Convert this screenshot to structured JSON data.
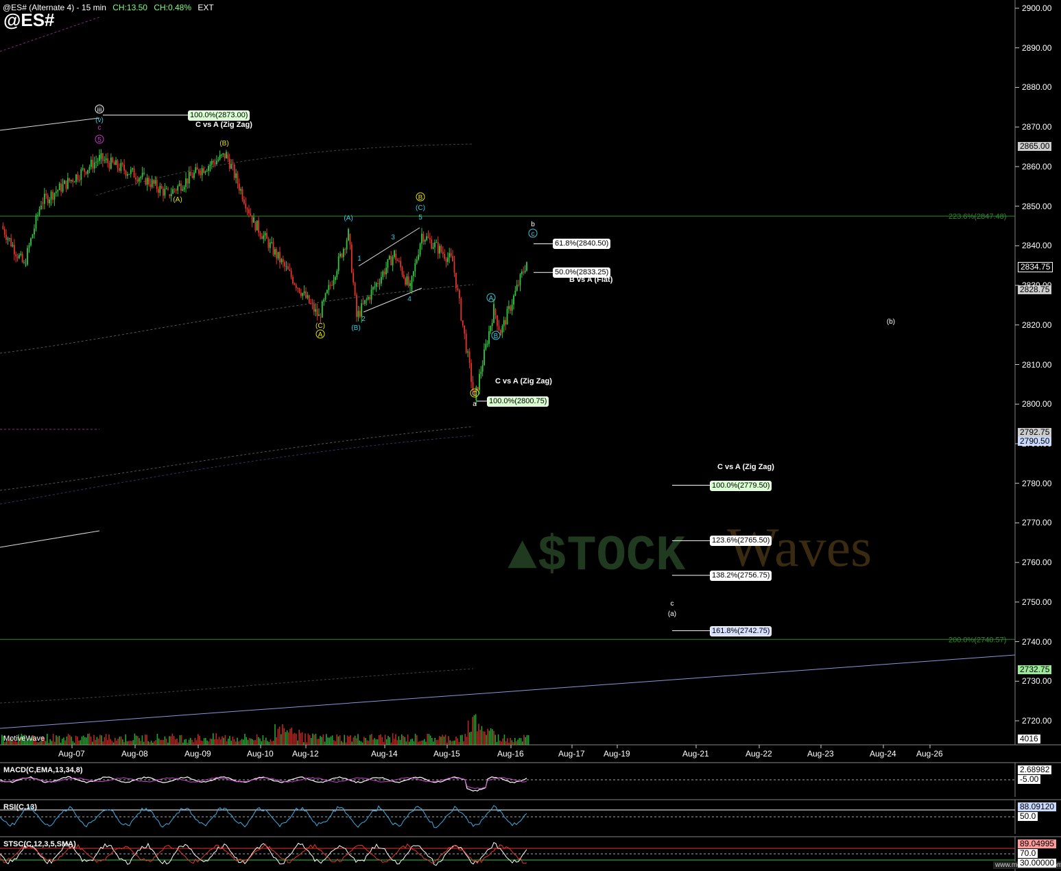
{
  "header": {
    "title": "@ES# (Alternate 4) - 15 min",
    "ch_points": "CH:13.50",
    "ch_pct": "CH:0.48%",
    "session": "EXT",
    "symbol": "@ES#"
  },
  "watermark_logo": "$TOCK Waves",
  "footer_brand": "MotiveWave",
  "footer_site": "www.motivewave.com",
  "colors": {
    "up_candle": "#2ecc40",
    "down_candle": "#e8342a",
    "fib_box_green": "#d8ffd0",
    "fib_box_white": "#ffffff",
    "fib_box_blue": "#d8e0ff",
    "wave_yellow": "#e6e600",
    "wave_cyan": "#33ccdd",
    "wave_magenta": "#cc33cc",
    "fib_line_green": "#2e8b2e"
  },
  "chart_data": {
    "type": "line",
    "title": "@ES# (Alternate 4) - 15 min",
    "ylim": [
      2713,
      2902
    ],
    "y_ticks": [
      2900,
      2890,
      2880,
      2870,
      2860,
      2850,
      2840,
      2830,
      2820,
      2810,
      2800,
      2790,
      2780,
      2770,
      2760,
      2750,
      2740,
      2730,
      2720
    ],
    "y_tick_labels": [
      "2900.00",
      "2890.00",
      "2880.00",
      "2870.00",
      "2860.00",
      "2850.00",
      "2840.00",
      "2830.00",
      "2820.00",
      "2810.00",
      "2800.00",
      "2790.00",
      "2780.00",
      "2770.00",
      "2760.00",
      "2750.00",
      "2740.00",
      "2730.00",
      "2720.00"
    ],
    "x_labels": [
      "Aug-07",
      "Aug-08",
      "Aug-09",
      "Aug-10",
      "Aug-12",
      "Aug-14",
      "Aug-15",
      "Aug-16",
      "Aug-17",
      "Aug-19",
      "Aug-21",
      "Aug-22",
      "Aug-23",
      "Aug-24",
      "Aug-26"
    ],
    "price_path": [
      {
        "x": "Aug-06",
        "y": 2845
      },
      {
        "x": "Aug-07",
        "y": 2835
      },
      {
        "x": "Aug-07",
        "y": 2851
      },
      {
        "x": "Aug-07",
        "y": 2862
      },
      {
        "x": "Aug-08",
        "y": 2857
      },
      {
        "x": "Aug-08",
        "y": 2853
      },
      {
        "x": "Aug-09",
        "y": 2859
      },
      {
        "x": "Aug-09",
        "y": 2863
      },
      {
        "x": "Aug-10",
        "y": 2846
      },
      {
        "x": "Aug-12",
        "y": 2822
      },
      {
        "x": "Aug-12",
        "y": 2843
      },
      {
        "x": "Aug-13",
        "y": 2822
      },
      {
        "x": "Aug-14",
        "y": 2838
      },
      {
        "x": "Aug-14",
        "y": 2829
      },
      {
        "x": "Aug-14",
        "y": 2843
      },
      {
        "x": "Aug-15",
        "y": 2836
      },
      {
        "x": "Aug-15",
        "y": 2801
      },
      {
        "x": "Aug-16",
        "y": 2824
      },
      {
        "x": "Aug-16",
        "y": 2818
      },
      {
        "x": "Aug-16",
        "y": 2836
      }
    ],
    "price_tags": [
      {
        "value": "2865.00",
        "color": "#cccccc"
      },
      {
        "value": "2834.75",
        "color": "#000000",
        "text_color": "#ffffff"
      },
      {
        "value": "2828.75",
        "color": "#cccccc"
      },
      {
        "value": "2792.75",
        "color": "#cccccc"
      },
      {
        "value": "2790.50",
        "color": "#c8d8ff"
      },
      {
        "value": "2732.75",
        "color": "#9be89b"
      }
    ],
    "fib_levels": [
      {
        "label": "100.0%(2873.00)",
        "value": 2873.0,
        "style": "green"
      },
      {
        "label": "61.8%(2840.50)",
        "value": 2840.5,
        "style": "white"
      },
      {
        "label": "50.0%(2833.25)",
        "value": 2833.25,
        "style": "white"
      },
      {
        "label": "100.0%(2800.75)",
        "value": 2800.75,
        "style": "green"
      },
      {
        "label": "100.0%(2779.50)",
        "value": 2779.5,
        "style": "green"
      },
      {
        "label": "123.6%(2765.50)",
        "value": 2765.5,
        "style": "white"
      },
      {
        "label": "138.2%(2756.75)",
        "value": 2756.75,
        "style": "white"
      },
      {
        "label": "161.8%(2742.75)",
        "value": 2742.75,
        "style": "blue"
      }
    ],
    "fib_lines_green": [
      {
        "label": "223.6%(2847.48)",
        "value": 2847.48
      },
      {
        "label": "200.0%(2740.57)",
        "value": 2740.57
      }
    ],
    "projection_titles": [
      "C vs A (Zig Zag)",
      "B vs A (Flat)",
      "C vs A (Zig Zag)",
      "C vs A (Zig Zag)"
    ],
    "wave_labels": [
      "iii",
      "(v)",
      "c",
      "5",
      "(B)",
      "(A)",
      "(C)",
      "A",
      "(A)",
      "(B)",
      "1",
      "2",
      "3",
      "4",
      "5",
      "B",
      "(C)",
      "A",
      "B",
      "C",
      "a",
      "b",
      "c",
      "(b)",
      "c",
      "(a)"
    ],
    "indicators": [
      {
        "name": "MACD(C,EMA,13,34,8)",
        "values": [
          "2.68982",
          "-5.00"
        ]
      },
      {
        "name": "RSI(C,13)",
        "values": [
          "88.09120",
          "50.0"
        ]
      },
      {
        "name": "STSC(C,12,3,5,SMA)",
        "values": [
          "89.04995",
          "70.0",
          "30.00000"
        ]
      }
    ],
    "volume_label": "4016"
  }
}
